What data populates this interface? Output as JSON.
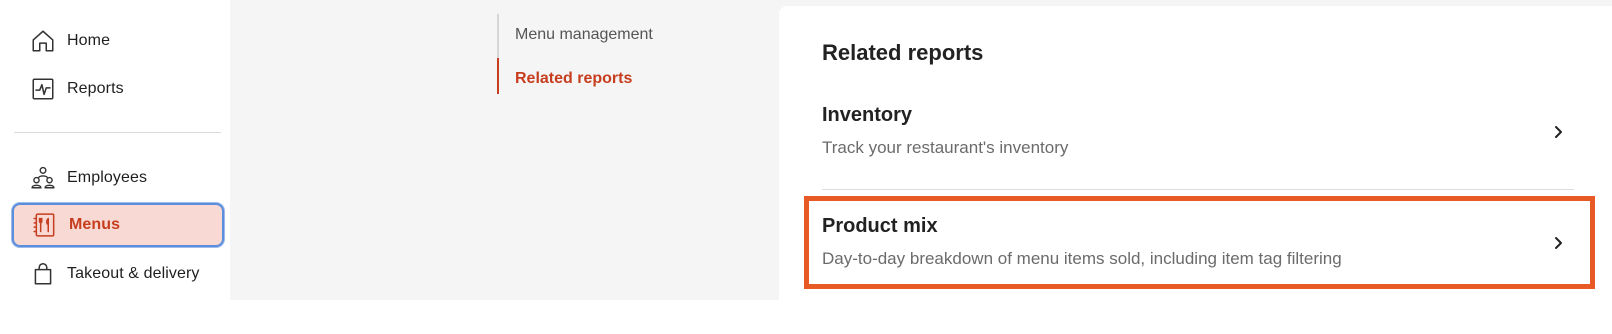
{
  "sidebar": {
    "items": [
      {
        "label": "Home",
        "icon": "home-icon"
      },
      {
        "label": "Reports",
        "icon": "reports-icon"
      },
      {
        "label": "Employees",
        "icon": "employees-icon"
      },
      {
        "label": "Menus",
        "icon": "menus-icon",
        "active": true
      },
      {
        "label": "Takeout & delivery",
        "icon": "shopping-bag-icon"
      }
    ]
  },
  "page_nav": {
    "links": [
      {
        "label": "Menu management"
      },
      {
        "label": "Related reports",
        "active": true
      }
    ]
  },
  "panel": {
    "title": "Related reports",
    "reports": [
      {
        "title": "Inventory",
        "description": "Track your restaurant's inventory"
      },
      {
        "title": "Product mix",
        "description": "Day-to-day breakdown of menu items sold, including item tag filtering"
      }
    ]
  },
  "colors": {
    "accent": "#c63e1e",
    "active_bg": "#f8d9d3",
    "focus_ring": "#5b8edb",
    "highlight": "#e85a25"
  }
}
